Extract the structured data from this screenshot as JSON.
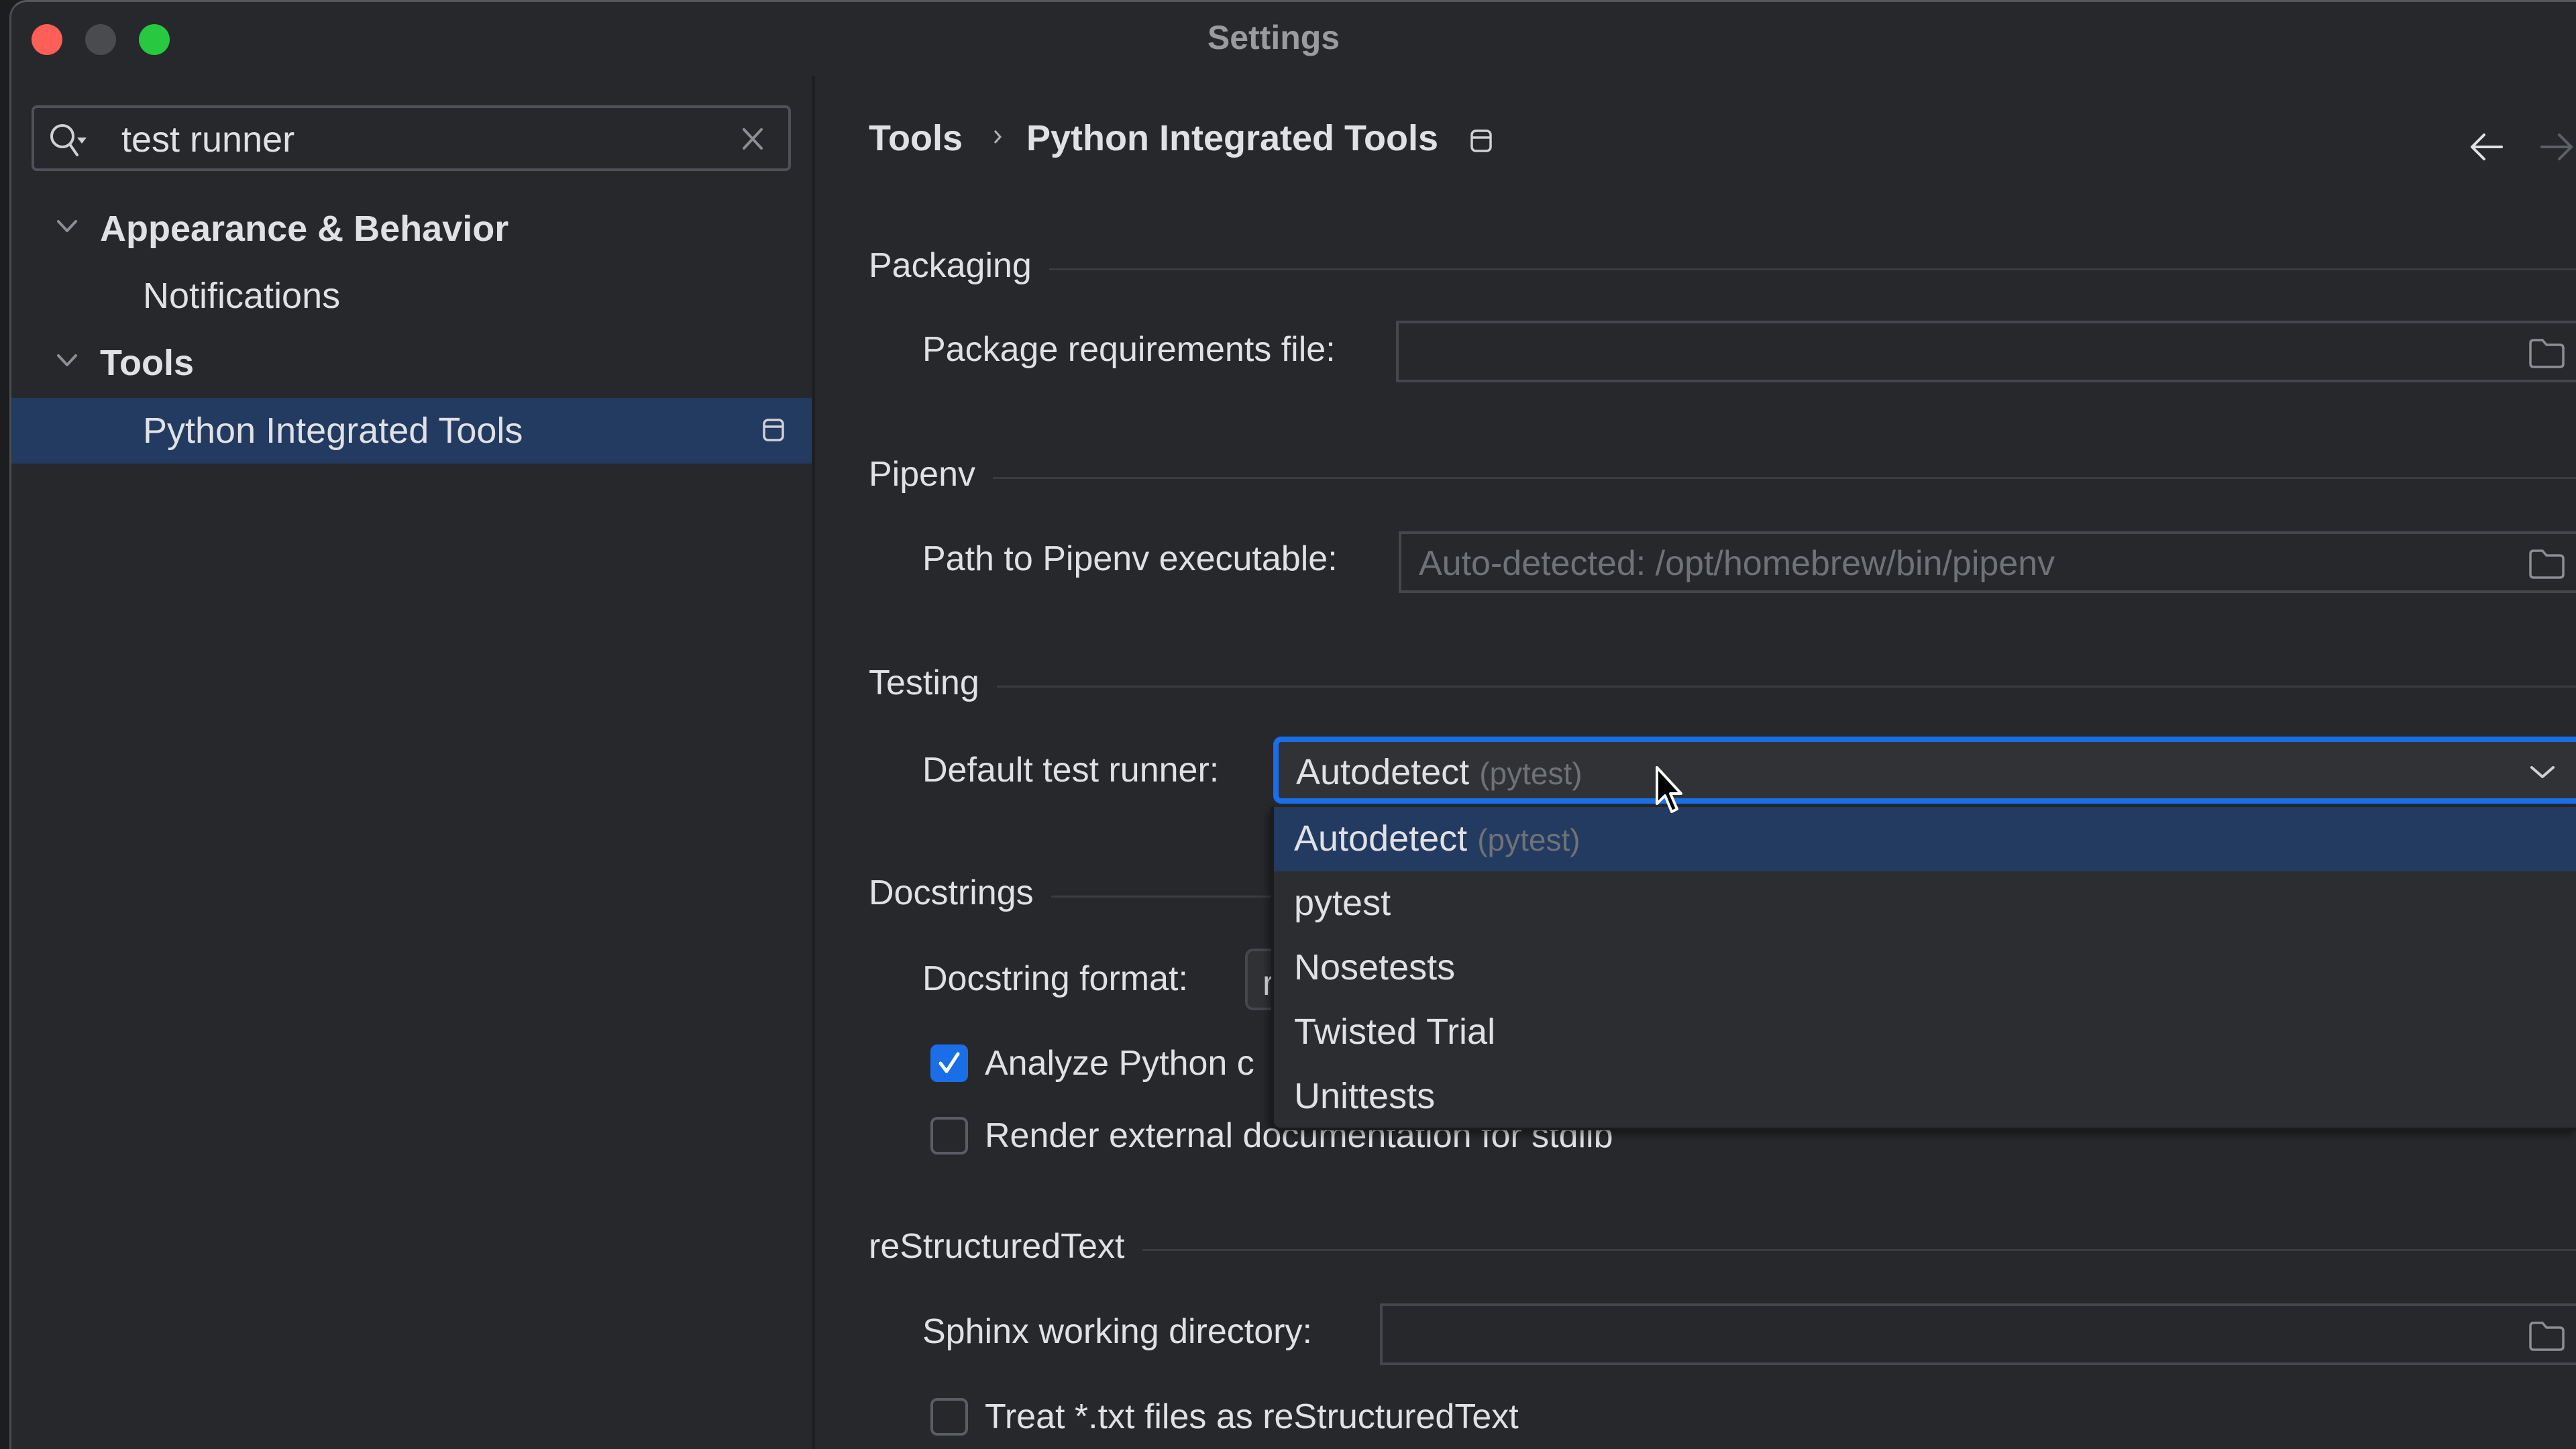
{
  "window": {
    "title": "Settings",
    "controls": {
      "close_color": "#ff5f57",
      "minimize_color": "#4a4b4e",
      "maximize_color": "#28c840"
    }
  },
  "sidebar": {
    "search": {
      "value": "test runner",
      "placeholder": ""
    },
    "tree": [
      {
        "label": "Appearance & Behavior",
        "expanded": true,
        "level": 0
      },
      {
        "label": "Notifications",
        "level": 1
      },
      {
        "label": "Tools",
        "expanded": true,
        "level": 0
      },
      {
        "label": "Python Integrated Tools",
        "level": 1,
        "selected": true
      }
    ]
  },
  "breadcrumb": {
    "parent": "Tools",
    "current": "Python Integrated Tools"
  },
  "sections": {
    "packaging": {
      "title": "Packaging",
      "requirements_label": "Package requirements file:",
      "requirements_value": ""
    },
    "pipenv": {
      "title": "Pipenv",
      "path_label": "Path to Pipenv executable:",
      "path_placeholder": "Auto-detected: /opt/homebrew/bin/pipenv"
    },
    "testing": {
      "title": "Testing",
      "runner_label": "Default test runner:",
      "runner_value": "Autodetect",
      "runner_hint": "(pytest)",
      "options": [
        {
          "label": "Autodetect",
          "hint": "(pytest)",
          "selected": true
        },
        {
          "label": "pytest",
          "hint": ""
        },
        {
          "label": "Nosetests",
          "hint": ""
        },
        {
          "label": "Twisted Trial",
          "hint": ""
        },
        {
          "label": "Unittests",
          "hint": ""
        }
      ]
    },
    "docstrings": {
      "title": "Docstrings",
      "format_label": "Docstring format:",
      "format_value_visible": "r",
      "analyze_label": "Analyze Python c",
      "analyze_checked": true,
      "render_label": "Render external documentation for stdlib",
      "render_checked": false
    },
    "restructuredtext": {
      "title": "reStructuredText",
      "sphinx_label": "Sphinx working directory:",
      "sphinx_value": "",
      "treat_txt_label": "Treat *.txt files as reStructuredText",
      "treat_txt_checked": false
    }
  },
  "colors": {
    "accent": "#1a6fe8",
    "selection": "#233a61",
    "background": "#27282b",
    "text": "#dfe1e5",
    "muted_text": "#6f7277"
  }
}
